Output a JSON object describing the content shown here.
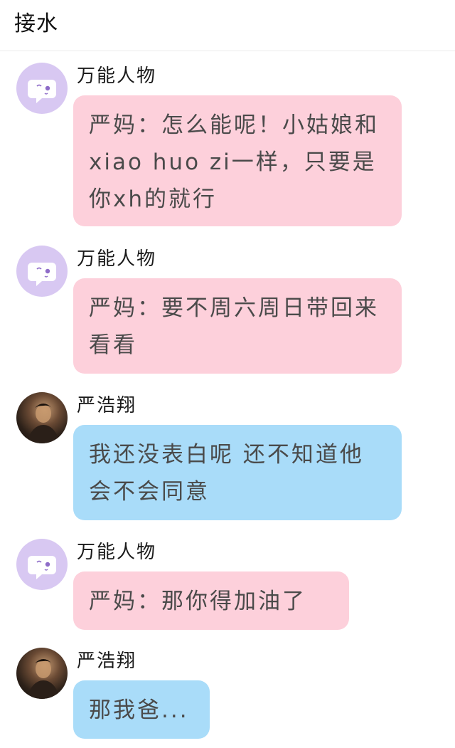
{
  "header": {
    "title": "接水"
  },
  "messages": [
    {
      "sender": "万能人物",
      "avatar": "bot-chat-icon",
      "color": "#fdd0db",
      "text": "严妈：怎么能呢！小姑娘和xiao huo zi一样，只要是你xh的就行"
    },
    {
      "sender": "万能人物",
      "avatar": "bot-chat-icon",
      "color": "#fdd0db",
      "text": "严妈：要不周六周日带回来看看"
    },
    {
      "sender": "严浩翔",
      "avatar": "user-photo",
      "color": "#a9dcf9",
      "text": "我还没表白呢 还不知道他会不会同意"
    },
    {
      "sender": "万能人物",
      "avatar": "bot-chat-icon",
      "color": "#fdd0db",
      "text": "严妈：那你得加油了"
    },
    {
      "sender": "严浩翔",
      "avatar": "user-photo",
      "color": "#a9dcf9",
      "text": "那我爸..."
    }
  ]
}
